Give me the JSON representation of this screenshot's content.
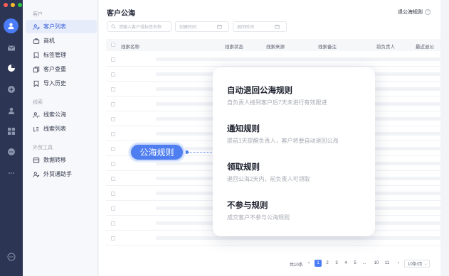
{
  "window": {
    "dots": [
      "#ff5f57",
      "#febc2e",
      "#28c840"
    ]
  },
  "rail": {
    "icons": [
      "user-icon",
      "mail-icon",
      "chart-icon",
      "chat-icon",
      "contacts-icon",
      "grid-icon",
      "message-icon",
      "more-icon",
      "help-icon"
    ]
  },
  "sidebar": {
    "sections": [
      {
        "label": "客户",
        "items": [
          {
            "label": "客户列表",
            "icon": "users-icon",
            "active": true
          },
          {
            "label": "商机",
            "icon": "briefcase-icon"
          },
          {
            "label": "标签管理",
            "icon": "tag-icon"
          },
          {
            "label": "客户查重",
            "icon": "copy-icon"
          },
          {
            "label": "导入历史",
            "icon": "bookmark-icon"
          }
        ]
      },
      {
        "label": "线索",
        "items": [
          {
            "label": "线索公海",
            "icon": "user-pool-icon"
          },
          {
            "label": "线索列表",
            "icon": "list-icon"
          }
        ]
      },
      {
        "label": "外贸工具",
        "items": [
          {
            "label": "数据转移",
            "icon": "transfer-icon"
          },
          {
            "label": "外贸通助手",
            "icon": "assistant-icon"
          }
        ]
      }
    ]
  },
  "main": {
    "title": "客户公海",
    "rule_link": "退公海规则",
    "filters": {
      "search_placeholder": "请输入客户或标签名称",
      "created_placeholder": "创建时间",
      "returned_placeholder": "退回时间"
    },
    "table": {
      "headers": [
        "线索名称",
        "线索状态",
        "线索来源",
        "线索备注",
        "前负责人",
        "最近退公"
      ]
    },
    "pager": {
      "total": "共10条",
      "pages": [
        "1",
        "2",
        "3",
        "4",
        "5",
        "...",
        "10",
        "11"
      ],
      "active_page": "1",
      "page_size": "10条/页"
    }
  },
  "overlay": {
    "badge": "公海规则",
    "rules": [
      {
        "title": "自动退回公海规则",
        "desc": "自负责人接到客户后7天未进行有效跟进"
      },
      {
        "title": "通知规则",
        "desc": "提前1天提醒负责人，客户将要自动退回公海"
      },
      {
        "title": "领取规则",
        "desc": "退回公海2天内，前负责人可领取"
      },
      {
        "title": "不参与规则",
        "desc": "成交客户不参与公海规则"
      }
    ]
  }
}
